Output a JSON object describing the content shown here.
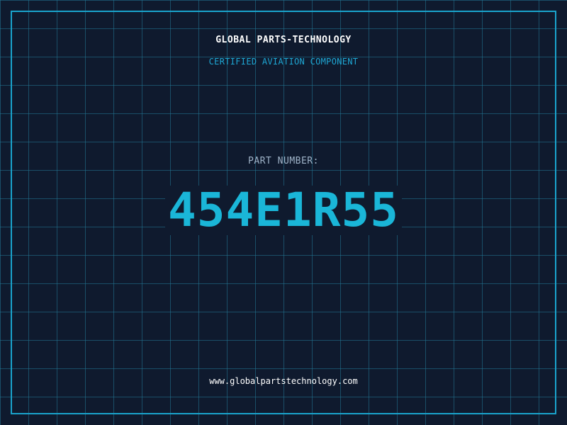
{
  "header": {
    "company": "GLOBAL PARTS-TECHNOLOGY",
    "tagline": "CERTIFIED AVIATION COMPONENT"
  },
  "part": {
    "label": "PART NUMBER:",
    "number": "454E1R55"
  },
  "footer": {
    "url": "www.globalpartstechnology.com"
  },
  "colors": {
    "background": "#0f1a2e",
    "grid": "#1f6f8a",
    "accent": "#1ab6d8",
    "frame": "#1aa3cc"
  }
}
